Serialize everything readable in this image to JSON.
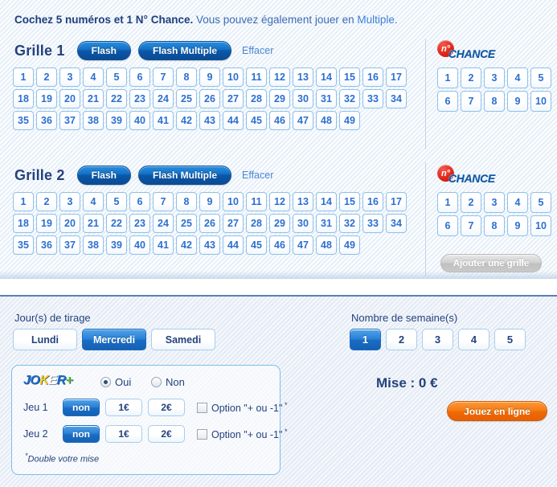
{
  "intro": {
    "bold_part": "Cochez 5 numéros et 1 N° Chance.",
    "normal_part": " Vous pouvez également jouer en ",
    "link_text": "Multiple",
    "trailing": "."
  },
  "grids": [
    {
      "title": "Grille 1",
      "flash_label": "Flash",
      "flash_multiple_label": "Flash Multiple",
      "clear_label": "Effacer",
      "numbers_row1": [
        1,
        2,
        3,
        4,
        5,
        6,
        7,
        8,
        9,
        10,
        11,
        12,
        13,
        14,
        15,
        16,
        17
      ],
      "numbers_row2": [
        18,
        19,
        20,
        21,
        22,
        23,
        24,
        25,
        26,
        27,
        28,
        29,
        30,
        31,
        32,
        33,
        34
      ],
      "numbers_row3": [
        35,
        36,
        37,
        38,
        39,
        40,
        41,
        42,
        43,
        44,
        45,
        46,
        47,
        48,
        49
      ],
      "chance": {
        "badge_text": "n°",
        "word_text": "CHANCE",
        "row1": [
          1,
          2,
          3,
          4,
          5
        ],
        "row2": [
          6,
          7,
          8,
          9,
          10
        ]
      }
    },
    {
      "title": "Grille 2",
      "flash_label": "Flash",
      "flash_multiple_label": "Flash Multiple",
      "clear_label": "Effacer",
      "numbers_row1": [
        1,
        2,
        3,
        4,
        5,
        6,
        7,
        8,
        9,
        10,
        11,
        12,
        13,
        14,
        15,
        16,
        17
      ],
      "numbers_row2": [
        18,
        19,
        20,
        21,
        22,
        23,
        24,
        25,
        26,
        27,
        28,
        29,
        30,
        31,
        32,
        33,
        34
      ],
      "numbers_row3": [
        35,
        36,
        37,
        38,
        39,
        40,
        41,
        42,
        43,
        44,
        45,
        46,
        47,
        48,
        49
      ],
      "chance": {
        "badge_text": "n°",
        "word_text": "CHANCE",
        "row1": [
          1,
          2,
          3,
          4,
          5
        ],
        "row2": [
          6,
          7,
          8,
          9,
          10
        ]
      }
    }
  ],
  "add_grid_label": "Ajouter une grille",
  "options": {
    "days_label": "Jour(s) de tirage",
    "days": [
      {
        "label": "Lundi",
        "selected": false
      },
      {
        "label": "Mercredi",
        "selected": true
      },
      {
        "label": "Samedi",
        "selected": false
      }
    ],
    "weeks_label": "Nombre de semaine(s)",
    "weeks": [
      {
        "label": "1",
        "selected": true
      },
      {
        "label": "2",
        "selected": false
      },
      {
        "label": "3",
        "selected": false
      },
      {
        "label": "4",
        "selected": false
      },
      {
        "label": "5",
        "selected": false
      }
    ]
  },
  "joker": {
    "logo_letters": [
      {
        "text": "J",
        "color": "blue"
      },
      {
        "text": "O",
        "color": "blue"
      },
      {
        "text": "K",
        "color": "yellow"
      },
      {
        "text": "E",
        "color": "white"
      },
      {
        "text": "R",
        "color": "blue"
      },
      {
        "text": "+",
        "color": "green"
      }
    ],
    "radio_yes_label": "Oui",
    "radio_no_label": "Non",
    "radio_selected": "Oui",
    "rows": [
      {
        "label": "Jeu 1",
        "amounts": [
          {
            "label": "non",
            "selected": true
          },
          {
            "label": "1€",
            "selected": false
          },
          {
            "label": "2€",
            "selected": false
          }
        ],
        "option_label": "Option \"+ ou -1\"",
        "option_sup": "*",
        "option_checked": false
      },
      {
        "label": "Jeu 2",
        "amounts": [
          {
            "label": "non",
            "selected": true
          },
          {
            "label": "1€",
            "selected": false
          },
          {
            "label": "2€",
            "selected": false
          }
        ],
        "option_label": "Option \"+ ou -1\"",
        "option_sup": "*",
        "option_checked": false
      }
    ],
    "footnote_sup": "*",
    "footnote": "Double votre mise"
  },
  "summary": {
    "stake_label": "Mise : 0 €",
    "play_button_label": "Jouez en ligne"
  },
  "colors": {
    "accent_blue": "#1a6cc2",
    "title_blue": "#24427c",
    "link_blue": "#3c80d8",
    "cell_border": "#8fc0ea",
    "orange": "#f57c15",
    "chance_red": "#e02718",
    "panel_bg": "#eaeff7"
  }
}
